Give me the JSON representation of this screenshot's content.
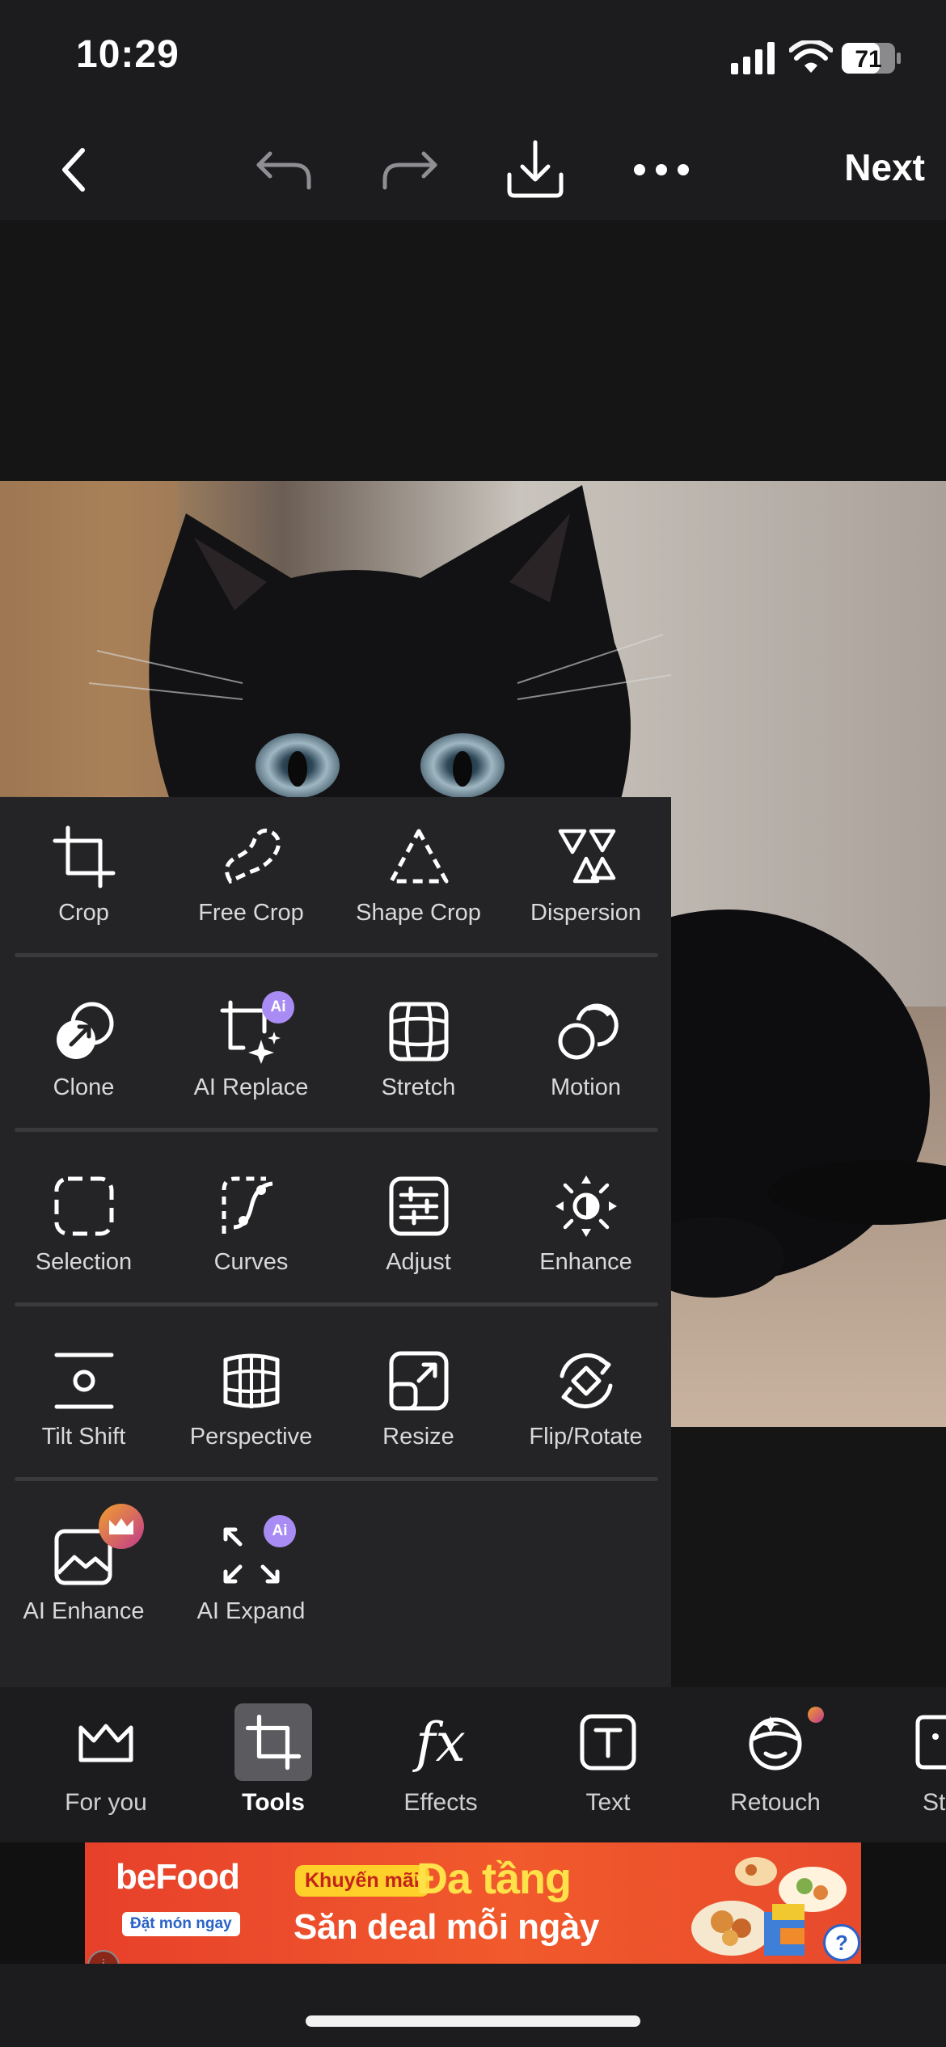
{
  "status_bar": {
    "time": "10:29",
    "battery": "71"
  },
  "toolbar": {
    "next_label": "Next"
  },
  "tools": {
    "rows": [
      [
        {
          "label": "Crop"
        },
        {
          "label": "Free Crop"
        },
        {
          "label": "Shape Crop"
        },
        {
          "label": "Dispersion"
        }
      ],
      [
        {
          "label": "Clone"
        },
        {
          "label": "AI Replace",
          "badge": "Ai"
        },
        {
          "label": "Stretch"
        },
        {
          "label": "Motion"
        }
      ],
      [
        {
          "label": "Selection"
        },
        {
          "label": "Curves"
        },
        {
          "label": "Adjust"
        },
        {
          "label": "Enhance"
        }
      ],
      [
        {
          "label": "Tilt Shift"
        },
        {
          "label": "Perspective"
        },
        {
          "label": "Resize"
        },
        {
          "label": "Flip/Rotate"
        }
      ],
      [
        {
          "label": "AI Enhance"
        },
        {
          "label": "AI Expand",
          "badge": "Ai"
        }
      ]
    ]
  },
  "bottom_nav": {
    "items": [
      {
        "label": "For you"
      },
      {
        "label": "Tools",
        "active": true
      },
      {
        "label": "Effects",
        "icon_text": "fx"
      },
      {
        "label": "Text"
      },
      {
        "label": "Retouch"
      },
      {
        "label": "Stic"
      }
    ]
  },
  "ad": {
    "brand": "beFood",
    "brand_sub": "Đặt món ngay",
    "promo_tag": "Khuyến mãi",
    "headline": "Đa tầng",
    "subline": "Săn deal mỗi ngày",
    "info_icon": "i",
    "help_icon": "?"
  },
  "colors": {
    "accent_ai": "#a98cf3",
    "ad_red": "#e7402b",
    "ad_yellow": "#ffe14a"
  }
}
